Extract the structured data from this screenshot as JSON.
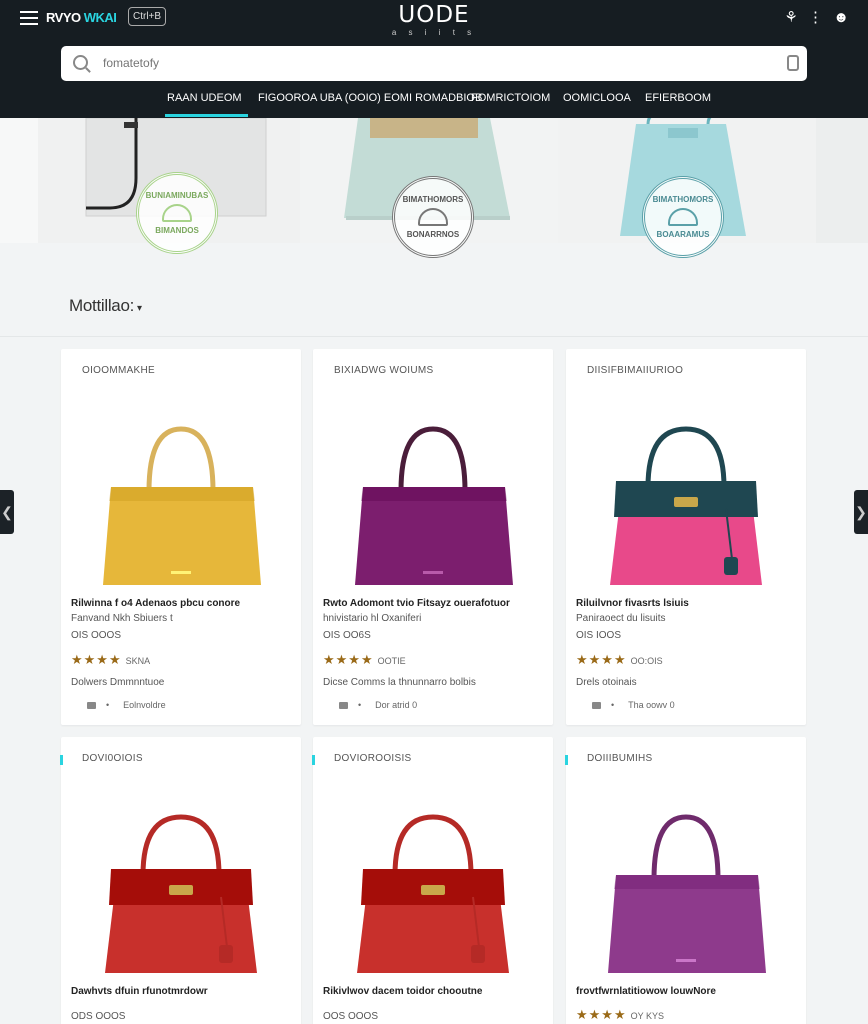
{
  "header": {
    "brand_left": "RVYO",
    "brand_left_accent": "WKAI",
    "brand_badge": "Ctrl+B",
    "logo_text": "UODE",
    "logo_sub": "a s i i t s",
    "icons_text": "⚘ ⋮ ☻",
    "icon_names": [
      "menu-icon",
      "search-icon",
      "bag-icon",
      "user-icon",
      "more-icon"
    ]
  },
  "search": {
    "placeholder": "fomatetofy"
  },
  "nav": {
    "items": [
      {
        "label": "RAAN UDEOM",
        "active": true
      },
      {
        "label": "FIGOOROA UBA (OOIO) EOMI ROMADBIOB"
      },
      {
        "label": "FOMRICTOIOM"
      },
      {
        "label": "OOMICLOOA"
      },
      {
        "label": "EFIERBOOM"
      }
    ]
  },
  "hero": {
    "stamps": [
      {
        "top": "BUNIAMINUBAS",
        "bottom": "BIMANDOS"
      },
      {
        "top": "BIMATHOMORS",
        "bottom": "BONARRNOS"
      },
      {
        "top": "BIMATHOMORS",
        "bottom": "BOAARAMUS"
      }
    ]
  },
  "section": {
    "title": "Mottillao:",
    "caret": "▾"
  },
  "arrows": {
    "left": "❮",
    "right": "❯"
  },
  "colors": {
    "header_bg": "#161d22",
    "accent": "#2ad4e0",
    "star": "#9a6a18"
  },
  "products": [
    {
      "category": "OIOOMMAKHE",
      "title": "Rilwinna f o4 Adenaos pbcu conore",
      "subtitle": "Fanvand Nkh Sbiuers t",
      "price": "OIS OOOS",
      "stars": "★★★★",
      "rating_count": "SKNA",
      "stock": "Dolwers Dmmnntuoe",
      "action": "Eolnvoldre",
      "bag_color": "#e6b73a",
      "handle_color": "#d8b25c",
      "bag_type": "tote"
    },
    {
      "category": "BIXIADWG WOIUMS",
      "title": "Rwto Adomont tvio Fitsayz ouerafotuor",
      "subtitle": "hnivistario hl Oxaniferi",
      "price": "OIS OO6S",
      "stars": "★★★★",
      "rating_count": "OOTIE",
      "stock": "Dicse Comms la thnunnarro bolbis",
      "action": "Dor atrid 0",
      "bag_color": "#7c1e6e",
      "handle_color": "#4a1d3a",
      "bag_type": "tote"
    },
    {
      "category": "DIISIFBIMAIIURIOO",
      "title": "Riluilvnor fivasrts lsiuis",
      "subtitle": "Paniraoect du lisuits",
      "price": "OIS IOOS",
      "stars": "★★★★",
      "rating_count": "OO:OIS",
      "stock": "Drels otoinais",
      "action": "Tha oowv 0",
      "bag_color": "#e8498a",
      "flap_color": "#1f4751",
      "handle_color": "#1f4751",
      "bag_type": "birkin"
    },
    {
      "category": "DOVI0OIOIS",
      "title": "Dawhvts dfuin rfunotmrdowr",
      "subtitle": "",
      "price": "ODS OOOS",
      "stars": "",
      "rating_count": "",
      "stock": "",
      "action": "",
      "bag_color": "#c8302c",
      "handle_color": "#b52a26",
      "bag_type": "birkin"
    },
    {
      "category": "DOVIOROOISIS",
      "title": "Rikivlwov dacem toidor chooutne",
      "subtitle": "",
      "price": "OOS OOOS",
      "stars": "",
      "rating_count": "",
      "stock": "",
      "action": "",
      "bag_color": "#c8302c",
      "handle_color": "#b52a26",
      "bag_type": "birkin"
    },
    {
      "category": "DOIIIBUMIHS",
      "title": "frovtfwrnlatitiowow louwNore",
      "subtitle": "",
      "price": "",
      "stars": "★★★★",
      "rating_count": "OY KYS",
      "stock": "",
      "action": "",
      "bag_color": "#8e3a8c",
      "handle_color": "#6f2b6c",
      "bag_type": "tote"
    }
  ]
}
